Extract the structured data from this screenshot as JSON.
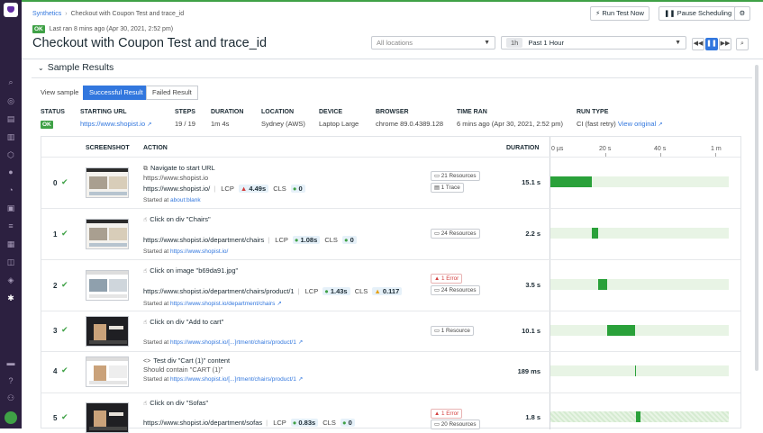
{
  "header": {
    "breadcrumb_root": "Synthetics",
    "breadcrumb_current": "Checkout with Coupon Test and trace_id",
    "status": "OK",
    "last_ran": "Last ran 8 mins ago (Apr 30, 2021, 2:52 pm)",
    "title": "Checkout with Coupon Test and trace_id",
    "run_now": "Run Test Now",
    "pause": "Pause Scheduling",
    "locations_placeholder": "All locations",
    "timeframe_chip": "1h",
    "timeframe": "Past 1 Hour"
  },
  "section": {
    "title": "Sample Results",
    "view_sample": "View sample",
    "tab_success": "Successful Result",
    "tab_failed": "Failed Result"
  },
  "meta": {
    "status_h": "STATUS",
    "status_v": "OK",
    "url_h": "STARTING URL",
    "url_v": "https://www.shopist.io",
    "steps_h": "STEPS",
    "steps_v": "19 / 19",
    "duration_h": "DURATION",
    "duration_v": "1m 4s",
    "location_h": "LOCATION",
    "location_v": "Sydney (AWS)",
    "device_h": "DEVICE",
    "device_v": "Laptop Large",
    "browser_h": "BROWSER",
    "browser_v": "chrome 89.0.4389.128",
    "time_h": "TIME RAN",
    "time_v": "6 mins ago (Apr 30, 2021, 2:52 pm)",
    "runtype_h": "RUN TYPE",
    "runtype_v": "CI (fast retry)",
    "view_original": "View original"
  },
  "table": {
    "col_screenshot": "SCREENSHOT",
    "col_action": "ACTION",
    "col_duration": "DURATION",
    "ticks": [
      "0 µs",
      "20 s",
      "40 s",
      "1 m"
    ],
    "rows": [
      {
        "idx": "0",
        "title": "Navigate to start URL",
        "sub": "https://www.shopist.io",
        "url": "https://www.shopist.io/",
        "lcp_label": "LCP",
        "lcp": "4.49s",
        "cls_label": "CLS",
        "cls": "0",
        "started_label": "Started at",
        "started_url": "about:blank",
        "tag1": "21 Resources",
        "tag2": "1 Trace",
        "duration": "15.1 s",
        "bar_start": 0,
        "bar_width": 15.1
      },
      {
        "idx": "1",
        "title": "Click on div \"Chairs\"",
        "url": "https://www.shopist.io/department/chairs",
        "lcp_label": "LCP",
        "lcp": "1.08s",
        "cls_label": "CLS",
        "cls": "0",
        "started_label": "Started at",
        "started_url": "https://www.shopist.io/",
        "tag1": "24 Resources",
        "duration": "2.2 s",
        "bar_start": 15.1,
        "bar_width": 2.2
      },
      {
        "idx": "2",
        "title": "Click on image \"b69da91.jpg\"",
        "url": "https://www.shopist.io/department/chairs/product/1",
        "lcp_label": "LCP",
        "lcp": "1.43s",
        "cls_label": "CLS",
        "cls": "0.117",
        "started_label": "Started at",
        "started_url": "https://www.shopist.io/department/chairs",
        "tag_err": "1 Error",
        "tag1": "24 Resources",
        "duration": "3.5 s",
        "bar_start": 17.3,
        "bar_width": 3.5
      },
      {
        "idx": "3",
        "title": "Click on div \"Add to cart\"",
        "started_label": "Started at",
        "started_url": "https://www.shopist.io/[...]rtment/chairs/product/1",
        "tag1": "1 Resource",
        "duration": "10.1 s",
        "bar_start": 20.8,
        "bar_width": 10.1
      },
      {
        "idx": "4",
        "title": "Test div \"Cart (1)\" content",
        "sub": "Should contain \"CART (1)\"",
        "started_label": "Started at",
        "started_url": "https://www.shopist.io/[...]rtment/chairs/product/1",
        "duration": "189 ms",
        "bar_start": 30.9,
        "bar_width": 0.189
      },
      {
        "idx": "5",
        "title": "Click on div \"Sofas\"",
        "url": "https://www.shopist.io/department/sofas",
        "lcp_label": "LCP",
        "lcp": "0.83s",
        "cls_label": "CLS",
        "cls": "0",
        "tag_err": "1 Error",
        "tag1": "20 Resources",
        "duration": "1.8 s",
        "bar_start": 31.1,
        "bar_width": 1.8
      }
    ]
  },
  "colors": {
    "accent": "#3277de",
    "ok": "#3fa146",
    "sidebar": "#2c2040",
    "bar": "#2aa13a"
  }
}
